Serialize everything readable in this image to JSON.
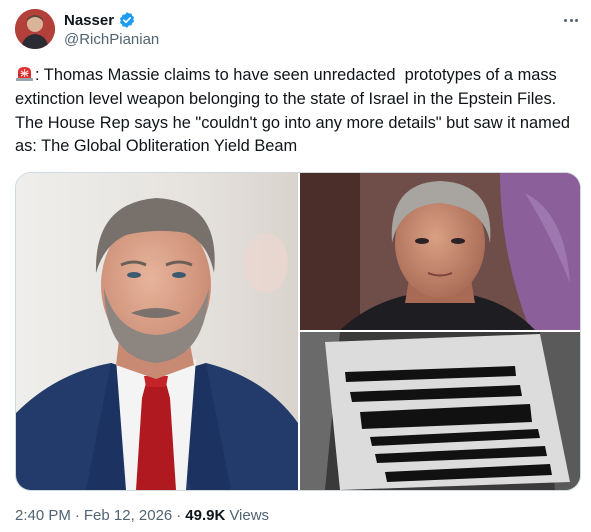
{
  "author": {
    "name": "Nasser",
    "handle": "@RichPianian",
    "verified_color": "#1d9bf0"
  },
  "more_icon": "more-horizontal-icon",
  "post": {
    "emoji_icon": "siren-icon",
    "text": ": Thomas Massie claims to have seen unredacted  prototypes of a mass extinction level weapon belonging to the state of Israel in the Epstein Files. The House Rep says he \"couldn't go into any more details\" but saw it named as: The Global Obliteration Yield Beam"
  },
  "media": [
    {
      "alt": "Photo of a grey-haired bearded man in a navy suit with a red tie"
    },
    {
      "alt": "Close-up photo of a grey-haired man"
    },
    {
      "alt": "Photo of redacted document pages"
    }
  ],
  "meta": {
    "time": "2:40 PM",
    "date": "Feb 12, 2026",
    "separator": "·",
    "views_count": "49.9K",
    "views_label": "Views"
  }
}
